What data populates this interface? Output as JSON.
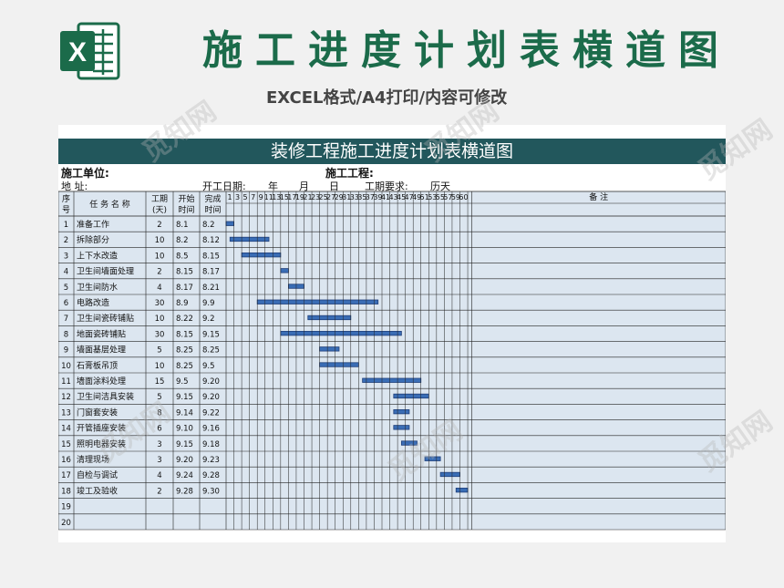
{
  "header": {
    "title": "施工进度计划表横道图",
    "subtitle": "EXCEL格式/A4打印/内容可修改",
    "logo_letter": "X"
  },
  "sheet": {
    "title": "装修工程施工进度计划表横道图",
    "info": {
      "unit_label": "施工单位:",
      "project_label": "施工工程:",
      "address_label": "地    址:",
      "start_label": "开工日期:",
      "year_label": "年",
      "month_label": "月",
      "day_label": "日",
      "duration_label": "工期要求:",
      "days_label": "历天"
    },
    "columns": {
      "seq": "序号",
      "task": "任 务 名 称",
      "duration": "工期(天)",
      "start": "开始时间",
      "end": "完成时间",
      "remark": "备    注"
    },
    "day_ticks": [
      "1",
      "3",
      "5",
      "7",
      "9",
      "11",
      "13",
      "15",
      "17",
      "19",
      "21",
      "23",
      "25",
      "27",
      "29",
      "31",
      "33",
      "35",
      "37",
      "39",
      "41",
      "43",
      "45",
      "47",
      "49",
      "51",
      "53",
      "55",
      "57",
      "59",
      "60"
    ],
    "rows": [
      {
        "seq": "1",
        "task": "准备工作",
        "duration": "2",
        "start": "8.1",
        "end": "8.2",
        "bar_start_day": 1,
        "bar_end_day": 3
      },
      {
        "seq": "2",
        "task": "拆除部分",
        "duration": "10",
        "start": "8.2",
        "end": "8.12",
        "bar_start_day": 2,
        "bar_end_day": 12
      },
      {
        "seq": "3",
        "task": "上下水改造",
        "duration": "10",
        "start": "8.5",
        "end": "8.15",
        "bar_start_day": 5,
        "bar_end_day": 15
      },
      {
        "seq": "4",
        "task": "卫生间墙面处理",
        "duration": "2",
        "start": "8.15",
        "end": "8.17",
        "bar_start_day": 15,
        "bar_end_day": 17
      },
      {
        "seq": "5",
        "task": "卫生间防水",
        "duration": "4",
        "start": "8.17",
        "end": "8.21",
        "bar_start_day": 17,
        "bar_end_day": 21
      },
      {
        "seq": "6",
        "task": "电路改造",
        "duration": "30",
        "start": "8.9",
        "end": "9.9",
        "bar_start_day": 9,
        "bar_end_day": 40
      },
      {
        "seq": "7",
        "task": "卫生间瓷砖铺贴",
        "duration": "10",
        "start": "8.22",
        "end": "9.2",
        "bar_start_day": 22,
        "bar_end_day": 33
      },
      {
        "seq": "8",
        "task": "地面瓷砖铺贴",
        "duration": "30",
        "start": "8.15",
        "end": "9.15",
        "bar_start_day": 15,
        "bar_end_day": 46
      },
      {
        "seq": "9",
        "task": "墙面基层处理",
        "duration": "5",
        "start": "8.25",
        "end": "8.25",
        "bar_start_day": 25,
        "bar_end_day": 30
      },
      {
        "seq": "10",
        "task": "石膏板吊顶",
        "duration": "10",
        "start": "8.25",
        "end": "9.5",
        "bar_start_day": 25,
        "bar_end_day": 35
      },
      {
        "seq": "11",
        "task": "墙面涂料处理",
        "duration": "15",
        "start": "9.5",
        "end": "9.20",
        "bar_start_day": 36,
        "bar_end_day": 51
      },
      {
        "seq": "12",
        "task": "卫生间洁具安装",
        "duration": "5",
        "start": "9.15",
        "end": "9.20",
        "bar_start_day": 44,
        "bar_end_day": 53
      },
      {
        "seq": "13",
        "task": "门窗套安装",
        "duration": "8",
        "start": "9.14",
        "end": "9.22",
        "bar_start_day": 44,
        "bar_end_day": 48
      },
      {
        "seq": "14",
        "task": "开管插座安装",
        "duration": "6",
        "start": "9.10",
        "end": "9.16",
        "bar_start_day": 44,
        "bar_end_day": 48
      },
      {
        "seq": "15",
        "task": "照明电器安装",
        "duration": "3",
        "start": "9.15",
        "end": "9.18",
        "bar_start_day": 46,
        "bar_end_day": 50
      },
      {
        "seq": "16",
        "task": "清理现场",
        "duration": "3",
        "start": "9.20",
        "end": "9.23",
        "bar_start_day": 52,
        "bar_end_day": 56
      },
      {
        "seq": "17",
        "task": "自检与调试",
        "duration": "4",
        "start": "9.24",
        "end": "9.28",
        "bar_start_day": 56,
        "bar_end_day": 61
      },
      {
        "seq": "18",
        "task": "竣工及验收",
        "duration": "2",
        "start": "9.28",
        "end": "9.30",
        "bar_start_day": 60,
        "bar_end_day": 63
      },
      {
        "seq": "19",
        "task": "",
        "duration": "",
        "start": "",
        "end": ""
      },
      {
        "seq": "20",
        "task": "",
        "duration": "",
        "start": "",
        "end": ""
      }
    ]
  },
  "watermark": "觅知网",
  "colors": {
    "title_green": "#1b6b4a",
    "header_teal": "#22575c",
    "cell_bg": "#dce6f0",
    "bar_fill": "#3a6db5",
    "bar_stroke": "#1f3f7a"
  }
}
